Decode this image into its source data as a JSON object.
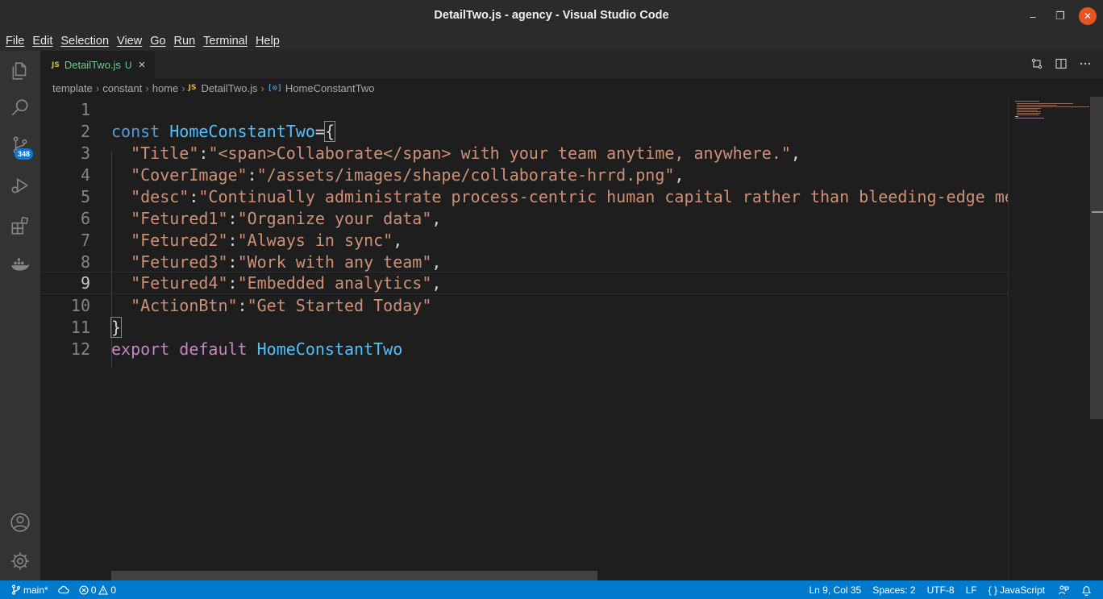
{
  "window": {
    "title": "DetailTwo.js - agency - Visual Studio Code",
    "minimize": "–",
    "maximize": "❐",
    "close": "✕"
  },
  "menu": [
    "File",
    "Edit",
    "Selection",
    "View",
    "Go",
    "Run",
    "Terminal",
    "Help"
  ],
  "activity": {
    "scm_badge": "348"
  },
  "tab": {
    "icon": "JS",
    "label": "DetailTwo.js",
    "modified": "U",
    "close": "×"
  },
  "breadcrumbs": {
    "parts": [
      "template",
      "constant",
      "home"
    ],
    "file_icon": "JS",
    "file": "DetailTwo.js",
    "symbol_icon": "[⊙]",
    "symbol": "HomeConstantTwo"
  },
  "editor": {
    "line_numbers": [
      "1",
      "2",
      "3",
      "4",
      "5",
      "6",
      "7",
      "8",
      "9",
      "10",
      "11",
      "12"
    ],
    "lines": {
      "l2": {
        "kw": "const",
        "name": "HomeConstantTwo",
        "op": "=",
        "brace": "{"
      },
      "l3": {
        "key": "\"Title\"",
        "colon": ":",
        "val": "\"<span>Collaborate</span> with your team anytime, anywhere.\"",
        "comma": ","
      },
      "l4": {
        "key": "\"CoverImage\"",
        "colon": ":",
        "val": "\"/assets/images/shape/collaborate-hrrd.png\"",
        "comma": ","
      },
      "l5": {
        "key": "\"desc\"",
        "colon": ":",
        "val": "\"Continually administrate process-centric human capital rather than bleeding-edge me"
      },
      "l6": {
        "key": "\"Fetured1\"",
        "colon": ":",
        "val": "\"Organize your data\"",
        "comma": ","
      },
      "l7": {
        "key": "\"Fetured2\"",
        "colon": ":",
        "val": "\"Always in sync\"",
        "comma": ","
      },
      "l8": {
        "key": "\"Fetured3\"",
        "colon": ":",
        "val": "\"Work with any team\"",
        "comma": ","
      },
      "l9": {
        "key": "\"Fetured4\"",
        "colon": ":",
        "val": "\"Embedded analytics\"",
        "comma": ","
      },
      "l10": {
        "key": "\"ActionBtn\"",
        "colon": ":",
        "val": "\"Get Started Today\""
      },
      "l11": {
        "brace": "}"
      },
      "l12": {
        "kw": "export",
        "kw2": "default",
        "name": "HomeConstantTwo"
      }
    }
  },
  "status": {
    "branch": "main*",
    "errors": "0",
    "warnings": "0",
    "position": "Ln 9, Col 35",
    "spaces": "Spaces: 2",
    "encoding": "UTF-8",
    "eol": "LF",
    "language_icon": "{ }",
    "language": "JavaScript"
  },
  "colors": {
    "accent": "#007acc",
    "string": "#ce9178",
    "keyword": "#569cd6",
    "class": "#4fc1ff",
    "control": "#c586c0"
  }
}
